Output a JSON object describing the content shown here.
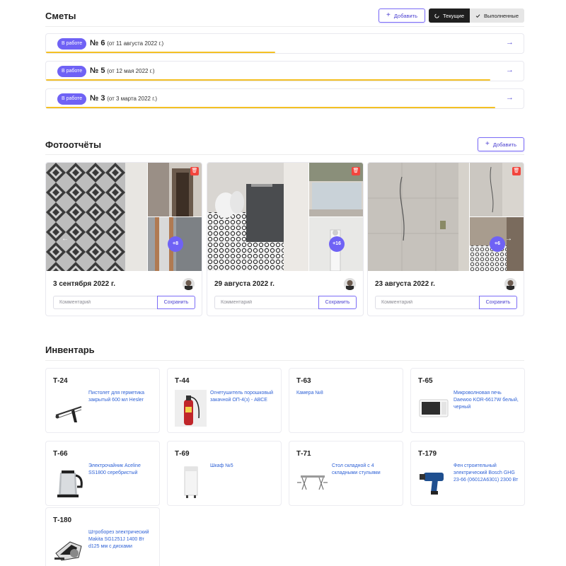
{
  "estimates": {
    "title": "Сметы",
    "add_label": "Добавить",
    "current_label": "Текущие",
    "done_label": "Выполненные",
    "items": [
      {
        "status": "В работе",
        "number": "№ 6",
        "date": "(от 11 августа 2022 г.)",
        "progress": 0.48
      },
      {
        "status": "В работе",
        "number": "№ 5",
        "date": "(от 12 мая 2022 г.)",
        "progress": 0.93
      },
      {
        "status": "В работе",
        "number": "№ 3",
        "date": "(от 3 марта 2022 г.)",
        "progress": 0.94
      }
    ]
  },
  "photos": {
    "title": "Фотоотчёты",
    "add_label": "Добавить",
    "comment_placeholder": "Комментарий",
    "save_label": "Сохранить",
    "items": [
      {
        "date": "3 сентября 2022 г.",
        "more": "+8"
      },
      {
        "date": "29 августа 2022 г.",
        "more": "+16"
      },
      {
        "date": "23 августа 2022 г.",
        "more": "+6"
      }
    ]
  },
  "inventory": {
    "title": "Инвентарь",
    "items": [
      {
        "code": "Т-24",
        "name": "Пистолет для герметика закрытый 600 мл Hesler",
        "icon": "caulk-gun"
      },
      {
        "code": "Т-44",
        "name": "Огнетушитель порошковый закачной ОП-4(з) - АВСЕ",
        "icon": "fire-extinguisher"
      },
      {
        "code": "Т-63",
        "name": "Камера №8",
        "icon": ""
      },
      {
        "code": "Т-65",
        "name": "Микроволновая печь Daewoo KOR-6617W белый, черный",
        "icon": "microwave"
      },
      {
        "code": "Т-66",
        "name": "Электрочайник Aceline SS1800 серебристый",
        "icon": "kettle"
      },
      {
        "code": "Т-69",
        "name": "Шкаф №5",
        "icon": "cabinet"
      },
      {
        "code": "Т-71",
        "name": "Стол складной с 4 складными стульями",
        "icon": "folding-table"
      },
      {
        "code": "Т-179",
        "name": "Фен строительный электрический Bosch GHG 23-66 (06012A6301) 2300 Вт",
        "icon": "heat-gun"
      },
      {
        "code": "Т-180",
        "name": "Штроборез электрический Makita SG1251J 1400 Вт d125 мм с дисками",
        "icon": "wall-chaser"
      }
    ]
  },
  "colors": {
    "accent": "#6f62f5",
    "progress": "#f4c024",
    "link": "#2f62d6",
    "danger": "#f2453d"
  }
}
